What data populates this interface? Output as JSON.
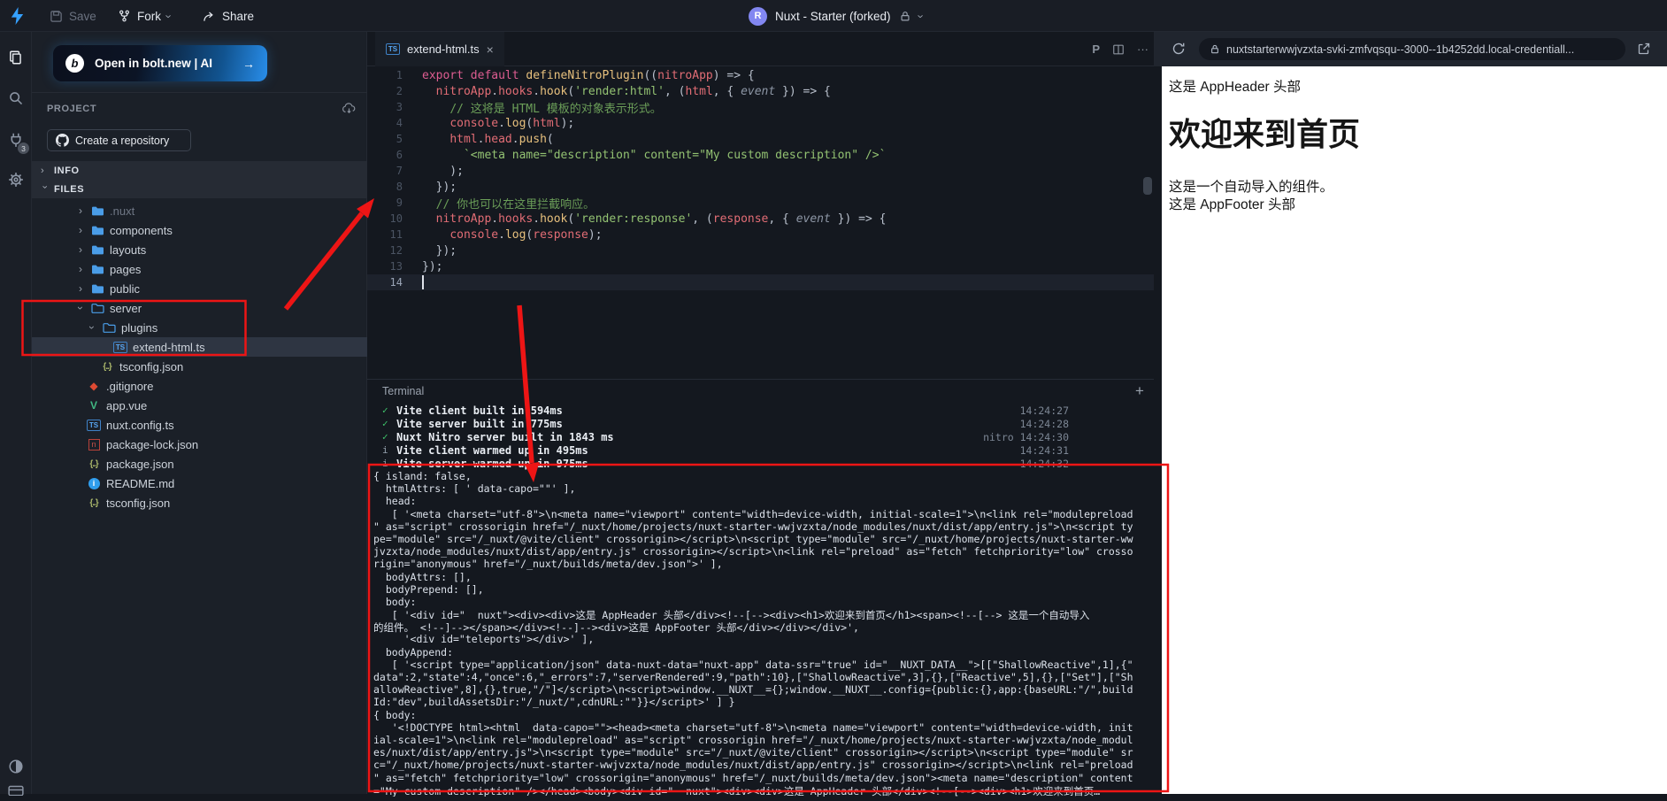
{
  "topbar": {
    "save": "Save",
    "fork": "Fork",
    "share": "Share",
    "avatar_initial": "R",
    "project_title": "Nuxt - Starter (forked)"
  },
  "activity": {
    "ports_badge": "3"
  },
  "explorer": {
    "bolt_button_label": "Open in bolt.new | AI",
    "bolt_logo_letter": "b",
    "bolt_arrow": "→",
    "project_label": "PROJECT",
    "create_repo_label": "Create a repository",
    "info_label": "INFO",
    "files_label": "FILES",
    "tree": [
      {
        "name": ".nuxt",
        "icon": "folder",
        "folder": true,
        "level": 0,
        "expanded": false,
        "dim": true
      },
      {
        "name": "components",
        "icon": "folder",
        "folder": true,
        "level": 0,
        "expanded": false
      },
      {
        "name": "layouts",
        "icon": "folder",
        "folder": true,
        "level": 0,
        "expanded": false
      },
      {
        "name": "pages",
        "icon": "folder",
        "folder": true,
        "level": 0,
        "expanded": false
      },
      {
        "name": "public",
        "icon": "folder",
        "folder": true,
        "level": 0,
        "expanded": false
      },
      {
        "name": "server",
        "icon": "folder-open",
        "folder": true,
        "level": 0,
        "expanded": true
      },
      {
        "name": "plugins",
        "icon": "folder-open",
        "folder": true,
        "level": 1,
        "expanded": true
      },
      {
        "name": "extend-html.ts",
        "icon": "ts",
        "level": 2,
        "selected": true
      },
      {
        "name": "tsconfig.json",
        "icon": "braces",
        "level": 1
      },
      {
        "name": ".gitignore",
        "icon": "git",
        "level": 0
      },
      {
        "name": "app.vue",
        "icon": "vue",
        "level": 0
      },
      {
        "name": "nuxt.config.ts",
        "icon": "ts",
        "level": 0
      },
      {
        "name": "package-lock.json",
        "icon": "npm",
        "level": 0
      },
      {
        "name": "package.json",
        "icon": "braces",
        "level": 0
      },
      {
        "name": "README.md",
        "icon": "info",
        "level": 0
      },
      {
        "name": "tsconfig.json",
        "icon": "braces",
        "level": 0
      }
    ]
  },
  "editor": {
    "tab_label": "extend-html.ts",
    "tab_badge": "TS",
    "tab_close": "×",
    "action_prettier": "P",
    "action_more": "···",
    "lines": [
      [
        {
          "t": "export default ",
          "c": "kw"
        },
        {
          "t": "defineNitroPlugin",
          "c": "fn"
        },
        {
          "t": "((",
          "c": "p"
        },
        {
          "t": "nitroApp",
          "c": "v"
        },
        {
          "t": ") ",
          "c": "p"
        },
        {
          "t": "=> {",
          "c": "p"
        }
      ],
      [
        {
          "t": "  ",
          "c": "p"
        },
        {
          "t": "nitroApp",
          "c": "v"
        },
        {
          "t": ".",
          "c": "p"
        },
        {
          "t": "hooks",
          "c": "v"
        },
        {
          "t": ".",
          "c": "p"
        },
        {
          "t": "hook",
          "c": "fn"
        },
        {
          "t": "(",
          "c": "p"
        },
        {
          "t": "'render:html'",
          "c": "str"
        },
        {
          "t": ", (",
          "c": "p"
        },
        {
          "t": "html",
          "c": "v"
        },
        {
          "t": ", { ",
          "c": "p"
        },
        {
          "t": "event",
          "c": "pr"
        },
        {
          "t": " }) => {",
          "c": "p"
        }
      ],
      [
        {
          "t": "    ",
          "c": "p"
        },
        {
          "t": "// 这将是 HTML 模板的对象表示形式。",
          "c": "cm"
        }
      ],
      [
        {
          "t": "    ",
          "c": "p"
        },
        {
          "t": "console",
          "c": "v"
        },
        {
          "t": ".",
          "c": "p"
        },
        {
          "t": "log",
          "c": "fn"
        },
        {
          "t": "(",
          "c": "p"
        },
        {
          "t": "html",
          "c": "v"
        },
        {
          "t": ");",
          "c": "p"
        }
      ],
      [
        {
          "t": "    ",
          "c": "p"
        },
        {
          "t": "html",
          "c": "v"
        },
        {
          "t": ".",
          "c": "p"
        },
        {
          "t": "head",
          "c": "v"
        },
        {
          "t": ".",
          "c": "p"
        },
        {
          "t": "push",
          "c": "fn"
        },
        {
          "t": "(",
          "c": "p"
        }
      ],
      [
        {
          "t": "      ",
          "c": "p"
        },
        {
          "t": "`<meta name=\"description\" content=\"My custom description\" />`",
          "c": "str"
        }
      ],
      [
        {
          "t": "    );",
          "c": "p"
        }
      ],
      [
        {
          "t": "  });",
          "c": "p"
        }
      ],
      [
        {
          "t": "  ",
          "c": "p"
        },
        {
          "t": "// 你也可以在这里拦截响应。",
          "c": "cm"
        }
      ],
      [
        {
          "t": "  ",
          "c": "p"
        },
        {
          "t": "nitroApp",
          "c": "v"
        },
        {
          "t": ".",
          "c": "p"
        },
        {
          "t": "hooks",
          "c": "v"
        },
        {
          "t": ".",
          "c": "p"
        },
        {
          "t": "hook",
          "c": "fn"
        },
        {
          "t": "(",
          "c": "p"
        },
        {
          "t": "'render:response'",
          "c": "str"
        },
        {
          "t": ", (",
          "c": "p"
        },
        {
          "t": "response",
          "c": "v"
        },
        {
          "t": ", { ",
          "c": "p"
        },
        {
          "t": "event",
          "c": "pr"
        },
        {
          "t": " }) => {",
          "c": "p"
        }
      ],
      [
        {
          "t": "    ",
          "c": "p"
        },
        {
          "t": "console",
          "c": "v"
        },
        {
          "t": ".",
          "c": "p"
        },
        {
          "t": "log",
          "c": "fn"
        },
        {
          "t": "(",
          "c": "p"
        },
        {
          "t": "response",
          "c": "v"
        },
        {
          "t": ");",
          "c": "p"
        }
      ],
      [
        {
          "t": "  });",
          "c": "p"
        }
      ],
      [
        {
          "t": "});",
          "c": "p"
        }
      ],
      []
    ]
  },
  "terminal": {
    "title": "Terminal",
    "add_button": "+",
    "build_lines": [
      {
        "icon": "✓",
        "cls": "ok",
        "text": "Vite client built in 594ms",
        "tag": "",
        "time": "14:24:27"
      },
      {
        "icon": "✓",
        "cls": "ok",
        "text": "Vite server built in 775ms",
        "tag": "",
        "time": "14:24:28"
      },
      {
        "icon": "✓",
        "cls": "ok",
        "text": "Nuxt Nitro server built in 1843 ms",
        "tag": "nitro",
        "time": "14:24:30"
      },
      {
        "icon": "i",
        "cls": "inf",
        "text": "Vite client warmed up in 495ms",
        "tag": "",
        "time": "14:24:31"
      },
      {
        "icon": "i",
        "cls": "inf",
        "text": "Vite server warmed up in 975ms",
        "tag": "",
        "time": "14:24:32"
      }
    ],
    "dump_lines": [
      "{ island: false,",
      "  htmlAttrs: [ ' data-capo=\"\"' ],",
      "  head:",
      "   [ '<meta charset=\"utf-8\">\\n<meta name=\"viewport\" content=\"width=device-width, initial-scale=1\">\\n<link rel=\"modulepreload",
      "\" as=\"script\" crossorigin href=\"/_nuxt/home/projects/nuxt-starter-wwjvzxta/node_modules/nuxt/dist/app/entry.js\">\\n<script ty",
      "pe=\"module\" src=\"/_nuxt/@vite/client\" crossorigin></script>\\n<script type=\"module\" src=\"/_nuxt/home/projects/nuxt-starter-ww",
      "jvzxta/node_modules/nuxt/dist/app/entry.js\" crossorigin></script>\\n<link rel=\"preload\" as=\"fetch\" fetchpriority=\"low\" crosso",
      "rigin=\"anonymous\" href=\"/_nuxt/builds/meta/dev.json\">' ],",
      "  bodyAttrs: [],",
      "  bodyPrepend: [],",
      "  body:",
      "   [ '<div id=\"__nuxt\"><div><div>这是 AppHeader 头部</div><!--[--><div><h1>欢迎来到首页</h1><span><!--[--> 这是一个自动导入",
      "的组件。 <!--]--></span></div><!--]--><div>这是 AppFooter 头部</div></div></div>',",
      "     '<div id=\"teleports\"></div>' ],",
      "  bodyAppend:",
      "   [ '<script type=\"application/json\" data-nuxt-data=\"nuxt-app\" data-ssr=\"true\" id=\"__NUXT_DATA__\">[[\"ShallowReactive\",1],{\"",
      "data\":2,\"state\":4,\"once\":6,\"_errors\":7,\"serverRendered\":9,\"path\":10},[\"ShallowReactive\",3],{},[\"Reactive\",5],{},[\"Set\"],[\"Sh",
      "allowReactive\",8],{},true,\"/\"]</script>\\n<script>window.__NUXT__={};window.__NUXT__.config={public:{},app:{baseURL:\"/\",build",
      "Id:\"dev\",buildAssetsDir:\"/_nuxt/\",cdnURL:\"\"}}</script>' ] }",
      "{ body:",
      "   '<!DOCTYPE html><html  data-capo=\"\"><head><meta charset=\"utf-8\">\\n<meta name=\"viewport\" content=\"width=device-width, init",
      "ial-scale=1\">\\n<link rel=\"modulepreload\" as=\"script\" crossorigin href=\"/_nuxt/home/projects/nuxt-starter-wwjvzxta/node_modul",
      "es/nuxt/dist/app/entry.js\">\\n<script type=\"module\" src=\"/_nuxt/@vite/client\" crossorigin></script>\\n<script type=\"module\" sr",
      "c=\"/_nuxt/home/projects/nuxt-starter-wwjvzxta/node_modules/nuxt/dist/app/entry.js\" crossorigin></script>\\n<link rel=\"preload",
      "\" as=\"fetch\" fetchpriority=\"low\" crossorigin=\"anonymous\" href=\"/_nuxt/builds/meta/dev.json\"><meta name=\"description\" content",
      "=\"My custom description\" /></head><body><div id=\"__nuxt\"><div><div>这是 AppHeader 头部</div><!--[--><div><h1>欢迎来到首页…"
    ]
  },
  "preview": {
    "url": "nuxtstarterwwjvzxta-svki-zmfvqsqu--3000--1b4252dd.local-credentiall...",
    "content": {
      "header": "这是 AppHeader 头部",
      "title": "欢迎来到首页",
      "line1": "这是一个自动导入的组件。",
      "line2": "这是 AppFooter 头部"
    }
  },
  "colors": {
    "annotation_red": "#ed1515",
    "bolt_blue": "#2e9bff",
    "folder_blue": "#4a9de8",
    "check_green": "#3ec26a"
  }
}
